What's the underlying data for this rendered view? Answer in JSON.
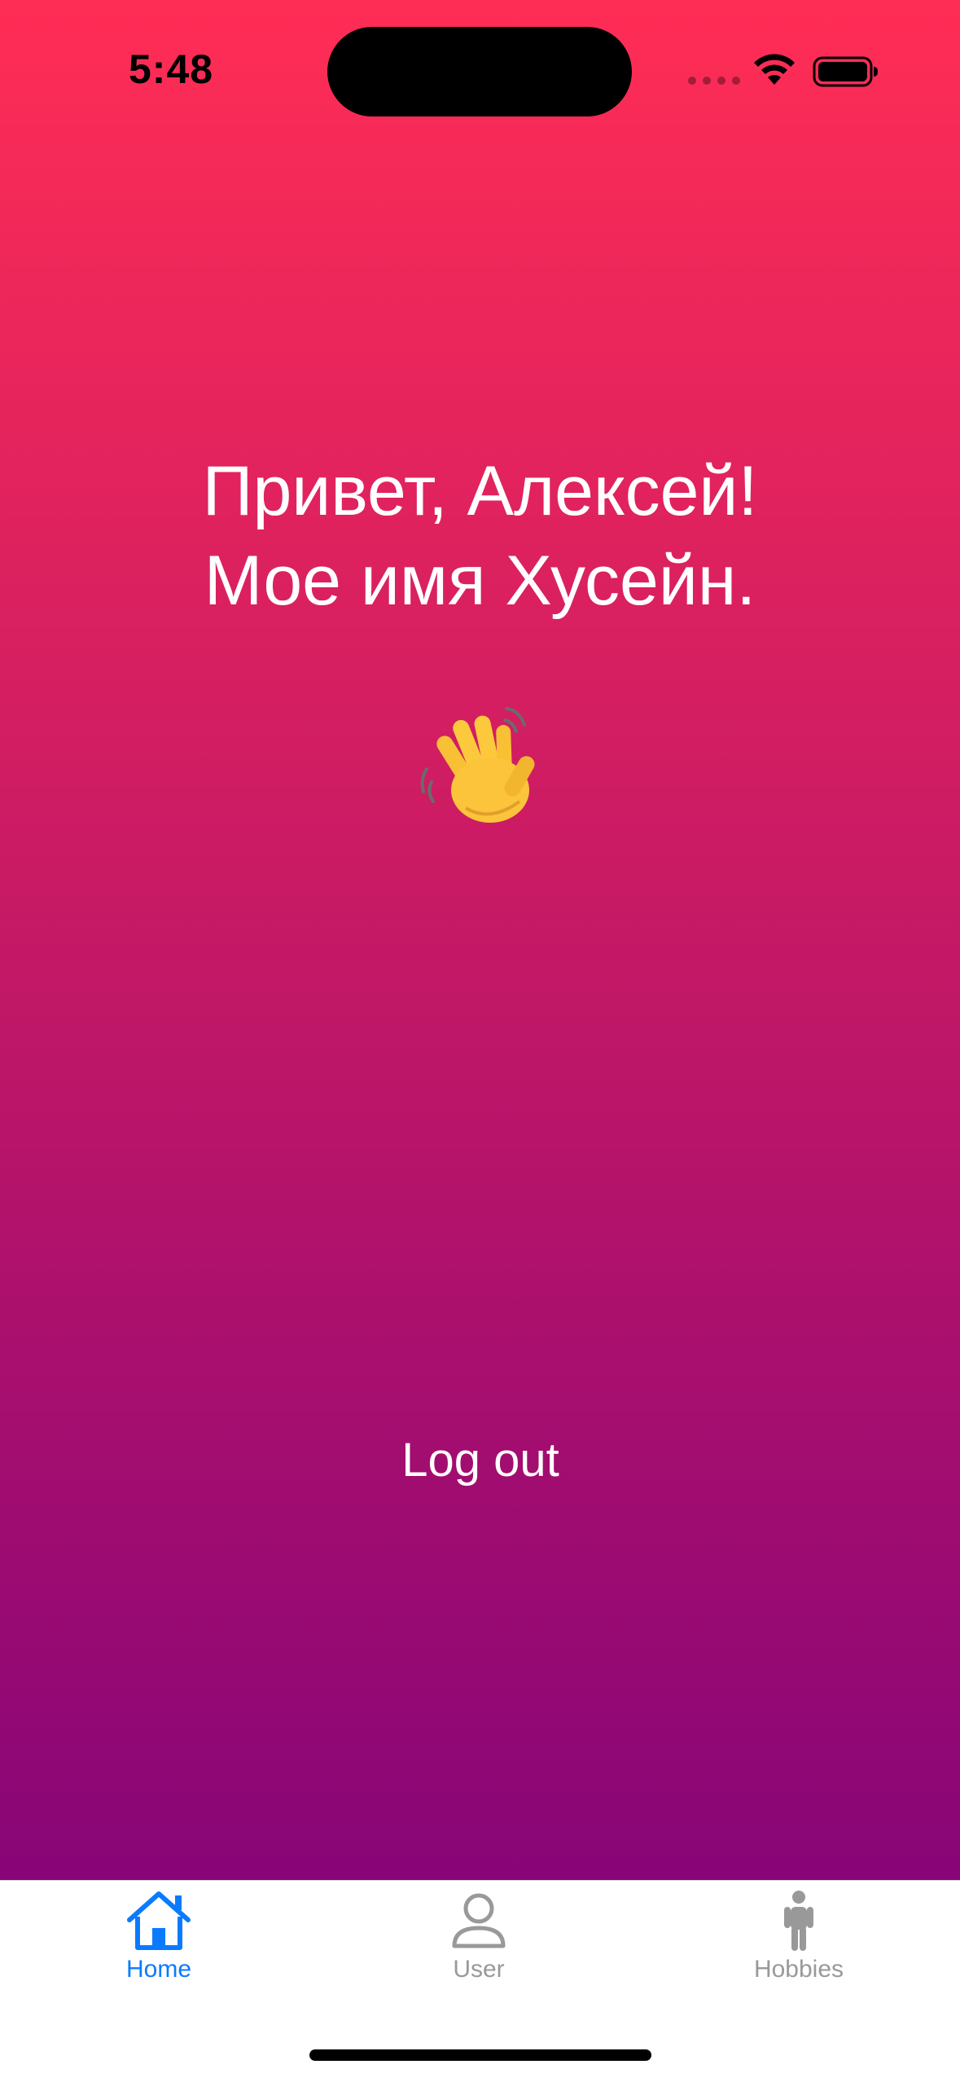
{
  "status_bar": {
    "time": "5:48"
  },
  "main": {
    "greeting_line1": "Привет, Алексей!",
    "greeting_line2": "Мое имя Хусейн.",
    "emoji_icon": "waving-hand-icon",
    "logout_label": "Log out"
  },
  "tab_bar": {
    "selected": "Home",
    "tabs": [
      {
        "label": "Home",
        "icon": "house-icon"
      },
      {
        "label": "User",
        "icon": "person-icon"
      },
      {
        "label": "Hobbies",
        "icon": "figure-stand-icon"
      }
    ]
  },
  "colors": {
    "gradient_top": "#ff2d55",
    "gradient_bottom": "#880577",
    "tab_selected": "#0a7bff",
    "tab_unselected": "#999999"
  }
}
